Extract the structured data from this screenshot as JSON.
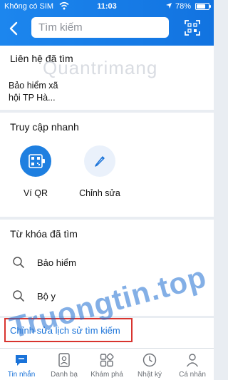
{
  "status_bar": {
    "carrier": "Không có SIM",
    "time": "11:03",
    "battery_pct": "78%",
    "battery_level": 0.78
  },
  "header": {
    "search_placeholder": "Tìm kiếm",
    "back_icon": "back-arrow-icon",
    "qr_icon": "qr-scan-icon"
  },
  "recent_contacts": {
    "title": "Liên hệ đã tìm",
    "items": [
      {
        "name": "Bảo hiểm xã hội TP Hà..."
      }
    ]
  },
  "quick_access": {
    "title": "Truy cập nhanh",
    "items": [
      {
        "label": "Ví QR",
        "icon": "qr-wallet-icon"
      },
      {
        "label": "Chỉnh sửa",
        "icon": "pencil-icon"
      }
    ]
  },
  "recent_keywords": {
    "title": "Từ khóa đã tìm",
    "items": [
      {
        "text": "Bảo hiểm"
      },
      {
        "text": "Bộ y"
      }
    ]
  },
  "edit_history_label": "Chỉnh sửa lịch sử tìm kiếm",
  "bottom_nav": [
    {
      "label": "Tin nhắn",
      "icon": "chat-icon",
      "active": true
    },
    {
      "label": "Danh bạ",
      "icon": "contacts-icon",
      "active": false
    },
    {
      "label": "Khám phá",
      "icon": "grid-icon",
      "active": false
    },
    {
      "label": "Nhật ký",
      "icon": "clock-icon",
      "active": false
    },
    {
      "label": "Cá nhân",
      "icon": "person-icon",
      "active": false
    }
  ],
  "watermarks": {
    "top": "Quantrimang",
    "bottom": "Truongtin.top"
  },
  "colors": {
    "brand_blue": "#1a73d9",
    "highlight_red": "#d8342f",
    "qr_blue": "#1e7fe0"
  }
}
